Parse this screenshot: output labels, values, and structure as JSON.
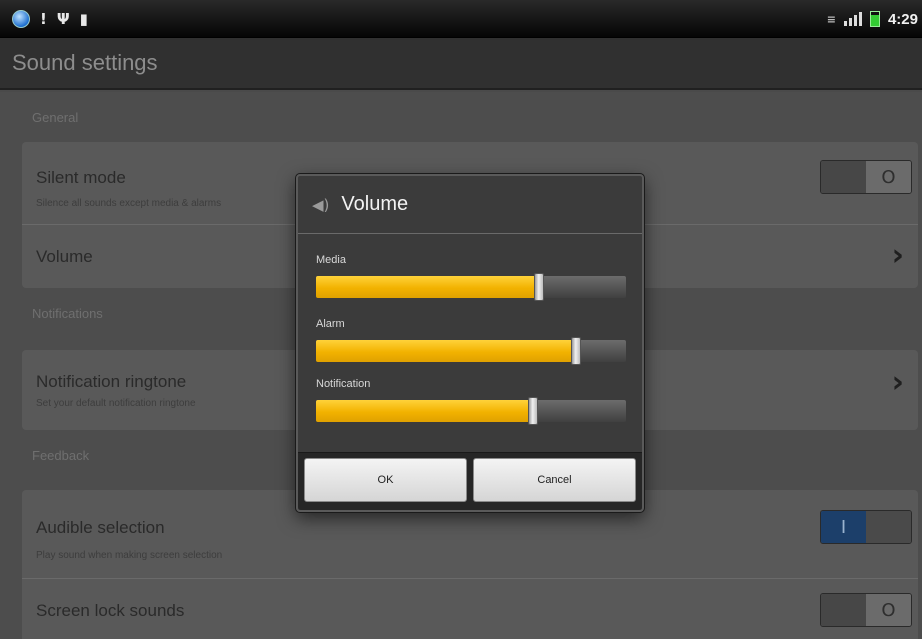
{
  "status_bar": {
    "time": "4:29",
    "left_icons": [
      "globe-icon",
      "alert-icon",
      "usb-icon",
      "sd-card-icon"
    ],
    "right_icons": [
      "network-type-icon",
      "signal-icon",
      "battery-icon"
    ]
  },
  "title": "Sound settings",
  "sections": {
    "general": "General",
    "notifications": "Notifications",
    "feedback": "Feedback"
  },
  "items": {
    "silent_mode": {
      "title": "Silent mode",
      "subtitle": "Silence all sounds except media & alarms",
      "toggle_symbol": "O",
      "enabled": false
    },
    "volume": {
      "title": "Volume"
    },
    "notification_ringtone": {
      "title": "Notification ringtone",
      "subtitle": "Set your default notification ringtone"
    },
    "audible_selection": {
      "title": "Audible selection",
      "subtitle": "Play sound when making screen selection",
      "toggle_symbol": "I",
      "enabled": true
    },
    "screen_lock_sounds": {
      "title": "Screen lock sounds",
      "toggle_symbol": "O",
      "enabled": false
    }
  },
  "dialog": {
    "title": "Volume",
    "icon": "speaker-icon",
    "sliders": [
      {
        "label": "Media",
        "level": 0.72
      },
      {
        "label": "Alarm",
        "level": 0.84
      },
      {
        "label": "Notification",
        "level": 0.7
      }
    ],
    "ok_label": "OK",
    "cancel_label": "Cancel"
  },
  "colors": {
    "slider_fill": "#f2b200",
    "toggle_on": "#1c3f6a"
  }
}
